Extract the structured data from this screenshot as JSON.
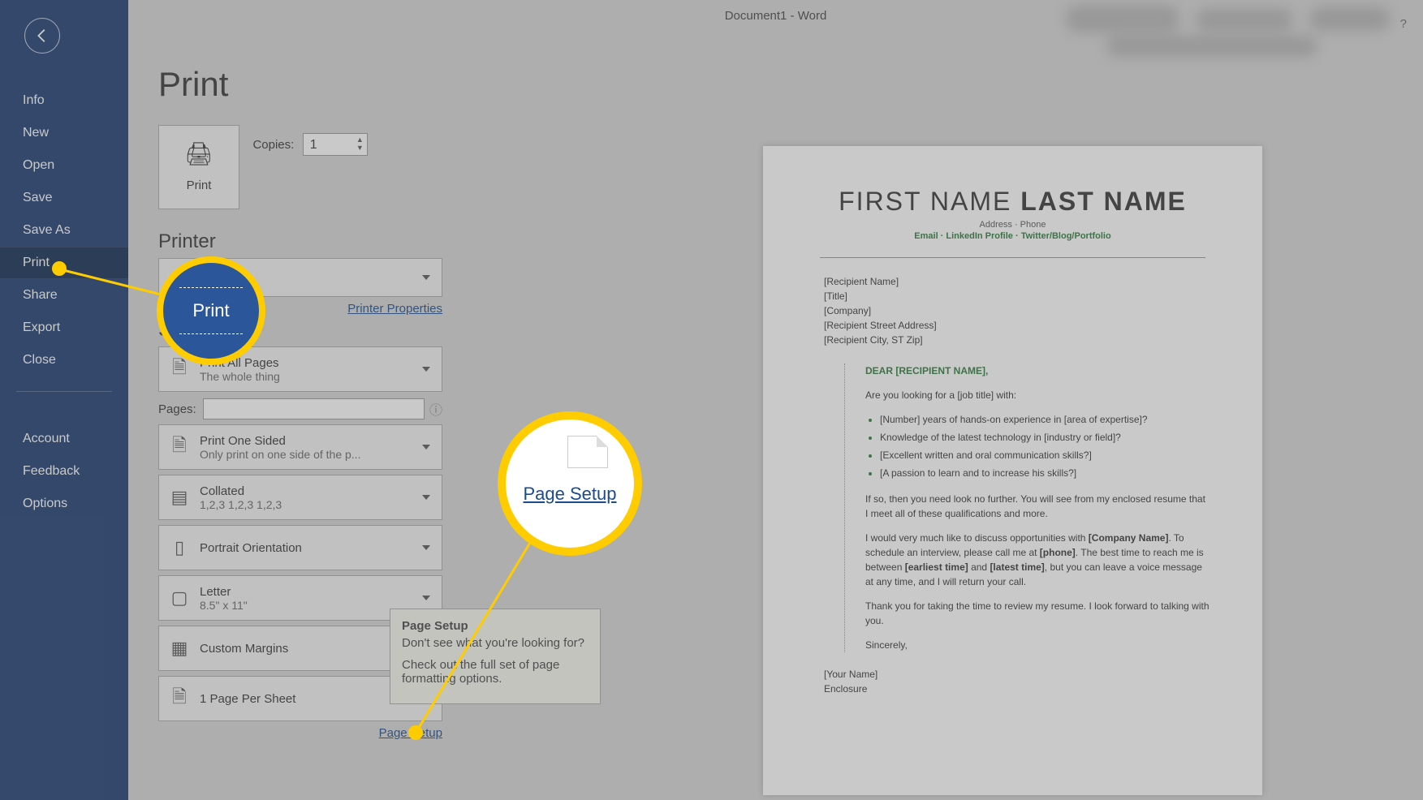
{
  "titlebar": "Document1  -  Word",
  "help": "?",
  "sidebar": {
    "items": [
      "Info",
      "New",
      "Open",
      "Save",
      "Save As",
      "Print",
      "Share",
      "Export",
      "Close"
    ],
    "items2": [
      "Account",
      "Feedback",
      "Options"
    ],
    "active": "Print"
  },
  "page": {
    "title": "Print",
    "print_button": "Print",
    "copies_label": "Copies:",
    "copies_value": "1",
    "printer_heading": "Printer",
    "printer_properties": "Printer Properties",
    "settings_heading": "Settings",
    "dropdowns": {
      "print_what": {
        "main": "Print All Pages",
        "sub": "The whole thing"
      },
      "sided": {
        "main": "Print One Sided",
        "sub": "Only print on one side of the p..."
      },
      "collate": {
        "main": "Collated",
        "sub": "1,2,3    1,2,3    1,2,3"
      },
      "orient": {
        "main": "Portrait Orientation"
      },
      "paper": {
        "main": "Letter",
        "sub": "8.5\" x 11\""
      },
      "margins": {
        "main": "Custom Margins"
      },
      "perpage": {
        "main": "1 Page Per Sheet"
      }
    },
    "pages_label": "Pages:",
    "page_setup_link": "Page Setup"
  },
  "tooltip": {
    "title": "Page Setup",
    "line1": "Don't see what you're looking for?",
    "line2": "Check out the full set of page formatting options."
  },
  "highlights": {
    "bubble1": "Print",
    "bubble2": "Page Setup"
  },
  "preview": {
    "first": "FIRST NAME ",
    "last": "LAST NAME",
    "meta": "Address · Phone",
    "links": "Email · LinkedIn Profile · Twitter/Blog/Portfolio",
    "recip": [
      "[Recipient Name]",
      "[Title]",
      "[Company]",
      "[Recipient Street Address]",
      "[Recipient City, ST Zip]"
    ],
    "greet": "DEAR [RECIPIENT NAME],",
    "intro": "Are you looking for a [job title] with:",
    "bullets": [
      "[Number] years of hands-on experience in [area of expertise]?",
      "Knowledge of the latest technology in [industry or field]?",
      "[Excellent written and oral communication skills?]",
      "[A passion to learn and to increase his skills?]"
    ],
    "p1": "If so, then you need look no further. You will see from my enclosed resume that I meet all of these qualifications and more.",
    "p2a": "I would very much like to discuss opportunities with ",
    "p2b": "[Company Name]",
    "p2c": ". To schedule an interview, please call me at ",
    "p2d": "[phone]",
    "p2e": ". The best time to reach me is between ",
    "p2f": "[earliest time]",
    "p2g": " and ",
    "p2h": "[latest time]",
    "p2i": ", but you can leave a voice message at any time, and I will return your call.",
    "p3": "Thank you for taking the time to review my resume. I look forward to talking with you.",
    "p4": "Sincerely,",
    "sign1": "[Your Name]",
    "sign2": "Enclosure"
  }
}
